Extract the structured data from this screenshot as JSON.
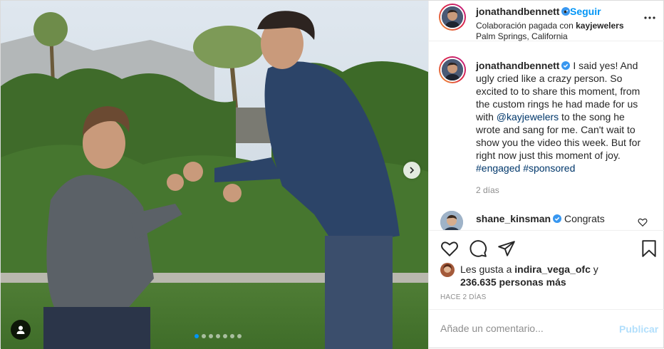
{
  "post": {
    "username": "jonathandbennett",
    "bullet": "•",
    "follow_label": "Seguir",
    "collab_prefix": "Colaboración pagada con ",
    "collab_partner": "kayjewelers",
    "location": "Palm Springs, California",
    "more_icon": "more-horizontal-icon",
    "verified_color": "#3897f0"
  },
  "caption": {
    "username": "jonathandbennett",
    "text_1": " I said yes! And ugly cried like a crazy person. So excited to to share this moment, from the custom rings he had made for us with ",
    "mention": "@kayjewelers",
    "text_2": " to the song he wrote and sang for me. Can't wait to show you the video this week. But for right now just this moment of joy. ",
    "hashtag_1": "#engaged",
    "hashtag_2": "#sponsored",
    "time": "2 días"
  },
  "comment": {
    "username": "shane_kinsman",
    "text": "Congrats"
  },
  "actions": {
    "like_icon": "heart-icon",
    "comment_icon": "comment-icon",
    "share_icon": "send-icon",
    "save_icon": "bookmark-icon"
  },
  "likes": {
    "prefix": "Les gusta a ",
    "user": "indira_vega_ofc",
    "suffix": " y",
    "count": "236.635 personas más"
  },
  "ago": "HACE 2 DÍAS",
  "add_comment": {
    "placeholder": "Añade un comentario...",
    "publish_label": "Publicar"
  },
  "carousel": {
    "total_slides": 7,
    "active_slide": 1
  },
  "colors": {
    "accent": "#0095f6",
    "link": "#00376b",
    "muted": "#8e8e8e",
    "publish_disabled": "#b2dffc"
  }
}
